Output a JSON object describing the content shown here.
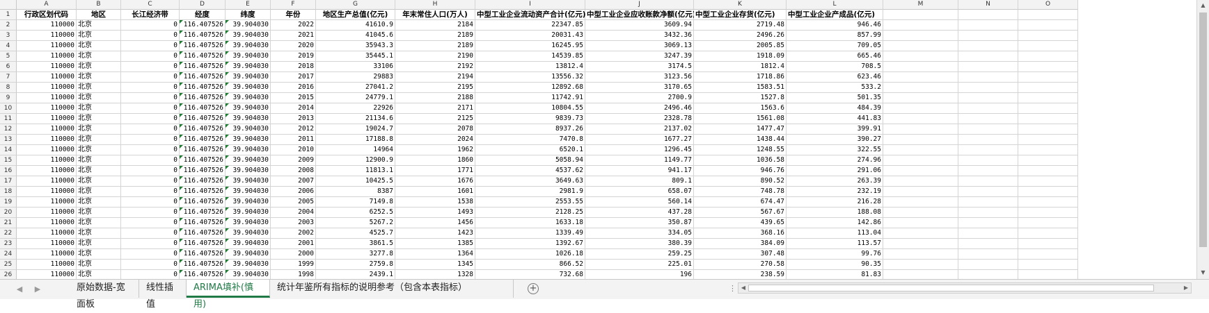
{
  "column_letters": [
    "A",
    "B",
    "C",
    "D",
    "E",
    "F",
    "G",
    "H",
    "I",
    "J",
    "K",
    "L",
    "M",
    "N",
    "O"
  ],
  "header_row_number": "1",
  "headers": [
    "行政区划代码",
    "地区",
    "长江经济带",
    "经度",
    "纬度",
    "年份",
    "地区生产总值(亿元)",
    "年末常住人口(万人)",
    "中型工业企业流动资产合计(亿元)",
    "中型工业企业应收账款净额(亿元)",
    "中型工业企业存货(亿元)",
    "中型工业企业产成品(亿元)"
  ],
  "rows": [
    {
      "n": "2",
      "a": "110000",
      "b": "北京",
      "c": "0",
      "d": "116.407526",
      "e": "39.904030",
      "f": "2022",
      "g": "41610.9",
      "h": "2184",
      "i": "22347.85",
      "j": "3609.94",
      "k": "2719.48",
      "l": "946.46"
    },
    {
      "n": "3",
      "a": "110000",
      "b": "北京",
      "c": "0",
      "d": "116.407526",
      "e": "39.904030",
      "f": "2021",
      "g": "41045.6",
      "h": "2189",
      "i": "20031.43",
      "j": "3432.36",
      "k": "2496.26",
      "l": "857.99"
    },
    {
      "n": "4",
      "a": "110000",
      "b": "北京",
      "c": "0",
      "d": "116.407526",
      "e": "39.904030",
      "f": "2020",
      "g": "35943.3",
      "h": "2189",
      "i": "16245.95",
      "j": "3069.13",
      "k": "2005.85",
      "l": "709.05"
    },
    {
      "n": "5",
      "a": "110000",
      "b": "北京",
      "c": "0",
      "d": "116.407526",
      "e": "39.904030",
      "f": "2019",
      "g": "35445.1",
      "h": "2190",
      "i": "14539.85",
      "j": "3247.39",
      "k": "1918.09",
      "l": "665.46"
    },
    {
      "n": "6",
      "a": "110000",
      "b": "北京",
      "c": "0",
      "d": "116.407526",
      "e": "39.904030",
      "f": "2018",
      "g": "33106",
      "h": "2192",
      "i": "13812.4",
      "j": "3174.5",
      "k": "1812.4",
      "l": "708.5"
    },
    {
      "n": "7",
      "a": "110000",
      "b": "北京",
      "c": "0",
      "d": "116.407526",
      "e": "39.904030",
      "f": "2017",
      "g": "29883",
      "h": "2194",
      "i": "13556.32",
      "j": "3123.56",
      "k": "1718.86",
      "l": "623.46"
    },
    {
      "n": "8",
      "a": "110000",
      "b": "北京",
      "c": "0",
      "d": "116.407526",
      "e": "39.904030",
      "f": "2016",
      "g": "27041.2",
      "h": "2195",
      "i": "12892.68",
      "j": "3170.65",
      "k": "1583.51",
      "l": "533.2"
    },
    {
      "n": "9",
      "a": "110000",
      "b": "北京",
      "c": "0",
      "d": "116.407526",
      "e": "39.904030",
      "f": "2015",
      "g": "24779.1",
      "h": "2188",
      "i": "11742.91",
      "j": "2700.9",
      "k": "1527.8",
      "l": "501.35"
    },
    {
      "n": "10",
      "a": "110000",
      "b": "北京",
      "c": "0",
      "d": "116.407526",
      "e": "39.904030",
      "f": "2014",
      "g": "22926",
      "h": "2171",
      "i": "10804.55",
      "j": "2496.46",
      "k": "1563.6",
      "l": "484.39"
    },
    {
      "n": "11",
      "a": "110000",
      "b": "北京",
      "c": "0",
      "d": "116.407526",
      "e": "39.904030",
      "f": "2013",
      "g": "21134.6",
      "h": "2125",
      "i": "9839.73",
      "j": "2328.78",
      "k": "1561.08",
      "l": "441.83"
    },
    {
      "n": "12",
      "a": "110000",
      "b": "北京",
      "c": "0",
      "d": "116.407526",
      "e": "39.904030",
      "f": "2012",
      "g": "19024.7",
      "h": "2078",
      "i": "8937.26",
      "j": "2137.02",
      "k": "1477.47",
      "l": "399.91"
    },
    {
      "n": "13",
      "a": "110000",
      "b": "北京",
      "c": "0",
      "d": "116.407526",
      "e": "39.904030",
      "f": "2011",
      "g": "17188.8",
      "h": "2024",
      "i": "7470.8",
      "j": "1677.27",
      "k": "1438.44",
      "l": "390.27"
    },
    {
      "n": "14",
      "a": "110000",
      "b": "北京",
      "c": "0",
      "d": "116.407526",
      "e": "39.904030",
      "f": "2010",
      "g": "14964",
      "h": "1962",
      "i": "6520.1",
      "j": "1296.45",
      "k": "1248.55",
      "l": "322.55"
    },
    {
      "n": "15",
      "a": "110000",
      "b": "北京",
      "c": "0",
      "d": "116.407526",
      "e": "39.904030",
      "f": "2009",
      "g": "12900.9",
      "h": "1860",
      "i": "5058.94",
      "j": "1149.77",
      "k": "1036.58",
      "l": "274.96"
    },
    {
      "n": "16",
      "a": "110000",
      "b": "北京",
      "c": "0",
      "d": "116.407526",
      "e": "39.904030",
      "f": "2008",
      "g": "11813.1",
      "h": "1771",
      "i": "4537.62",
      "j": "941.17",
      "k": "946.76",
      "l": "291.06"
    },
    {
      "n": "17",
      "a": "110000",
      "b": "北京",
      "c": "0",
      "d": "116.407526",
      "e": "39.904030",
      "f": "2007",
      "g": "10425.5",
      "h": "1676",
      "i": "3649.63",
      "j": "809.1",
      "k": "890.52",
      "l": "263.39"
    },
    {
      "n": "18",
      "a": "110000",
      "b": "北京",
      "c": "0",
      "d": "116.407526",
      "e": "39.904030",
      "f": "2006",
      "g": "8387",
      "h": "1601",
      "i": "2981.9",
      "j": "658.07",
      "k": "748.78",
      "l": "232.19"
    },
    {
      "n": "19",
      "a": "110000",
      "b": "北京",
      "c": "0",
      "d": "116.407526",
      "e": "39.904030",
      "f": "2005",
      "g": "7149.8",
      "h": "1538",
      "i": "2553.55",
      "j": "560.14",
      "k": "674.47",
      "l": "216.28"
    },
    {
      "n": "20",
      "a": "110000",
      "b": "北京",
      "c": "0",
      "d": "116.407526",
      "e": "39.904030",
      "f": "2004",
      "g": "6252.5",
      "h": "1493",
      "i": "2128.25",
      "j": "437.28",
      "k": "567.67",
      "l": "188.08"
    },
    {
      "n": "21",
      "a": "110000",
      "b": "北京",
      "c": "0",
      "d": "116.407526",
      "e": "39.904030",
      "f": "2003",
      "g": "5267.2",
      "h": "1456",
      "i": "1633.18",
      "j": "350.87",
      "k": "439.65",
      "l": "142.86"
    },
    {
      "n": "22",
      "a": "110000",
      "b": "北京",
      "c": "0",
      "d": "116.407526",
      "e": "39.904030",
      "f": "2002",
      "g": "4525.7",
      "h": "1423",
      "i": "1339.49",
      "j": "334.05",
      "k": "368.16",
      "l": "113.04"
    },
    {
      "n": "23",
      "a": "110000",
      "b": "北京",
      "c": "0",
      "d": "116.407526",
      "e": "39.904030",
      "f": "2001",
      "g": "3861.5",
      "h": "1385",
      "i": "1392.67",
      "j": "380.39",
      "k": "384.09",
      "l": "113.57"
    },
    {
      "n": "24",
      "a": "110000",
      "b": "北京",
      "c": "0",
      "d": "116.407526",
      "e": "39.904030",
      "f": "2000",
      "g": "3277.8",
      "h": "1364",
      "i": "1026.18",
      "j": "259.25",
      "k": "307.48",
      "l": "99.76"
    },
    {
      "n": "25",
      "a": "110000",
      "b": "北京",
      "c": "0",
      "d": "116.407526",
      "e": "39.904030",
      "f": "1999",
      "g": "2759.8",
      "h": "1345",
      "i": "866.52",
      "j": "225.01",
      "k": "270.58",
      "l": "90.35"
    },
    {
      "n": "26",
      "a": "110000",
      "b": "北京",
      "c": "0",
      "d": "116.407526",
      "e": "39.904030",
      "f": "1998",
      "g": "2439.1",
      "h": "1328",
      "i": "732.68",
      "j": "196",
      "k": "238.59",
      "l": "81.83"
    }
  ],
  "sheet_tabs": [
    {
      "label": "原始数据-宽面板",
      "active": false
    },
    {
      "label": "线性插值",
      "active": false
    },
    {
      "label": "ARIMA填补(慎用)",
      "active": true
    },
    {
      "label": "统计年鉴所有指标的说明参考（包含本表指标）",
      "active": false
    }
  ],
  "icons": {
    "nav_prev": "chevron-left-icon",
    "nav_next": "chevron-right-icon",
    "add_sheet": "plus-circle-icon",
    "more": "ellipsis-icon"
  },
  "glyphs": {
    "nav_prev": "◀",
    "nav_next": "▶",
    "add_sheet": "+",
    "more": "⋮",
    "scroll_up": "▲",
    "scroll_down": "▼",
    "scroll_left": "◀",
    "scroll_right": "▶"
  },
  "colors": {
    "active_tab": "#1f7a46",
    "comment_marker": "#d40000",
    "number_as_text_marker": "#1e7d32"
  }
}
